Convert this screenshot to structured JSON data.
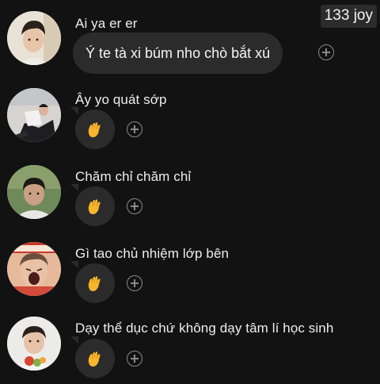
{
  "counter": "133 joy",
  "messages": [
    {
      "name": "Ai ya er er",
      "text": "Ý te tà xi búm nho chò bắt xú",
      "avatar_icon": "avatar-photo-icon"
    },
    {
      "name": "Ây yo quát sớp",
      "emoji": "clap-emoji",
      "avatar_icon": "avatar-photo-icon"
    },
    {
      "name": "Chăm chỉ chăm chỉ",
      "emoji": "clap-emoji",
      "avatar_icon": "avatar-photo-icon"
    },
    {
      "name": "Gì tao chủ nhiệm lớp bên",
      "emoji": "clap-emoji",
      "avatar_icon": "avatar-photo-icon"
    },
    {
      "name": "Dạy thể dục chứ không dạy tâm lí học sinh",
      "emoji": "clap-emoji",
      "avatar_icon": "avatar-photo-icon"
    }
  ],
  "colors": {
    "background": "#121212",
    "bubble": "#2b2b2b",
    "text": "#f5f5f5",
    "icon_gray": "#8a8a8a",
    "emoji_yellow": "#f7b52c"
  }
}
